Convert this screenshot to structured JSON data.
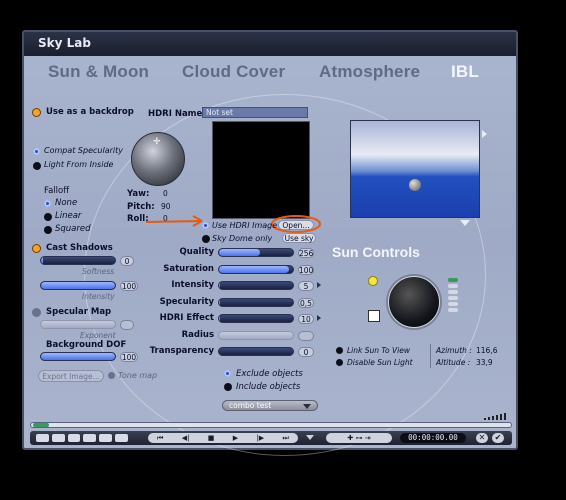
{
  "window": {
    "title": "Sky Lab"
  },
  "tabs": [
    "Sun & Moon",
    "Cloud Cover",
    "Atmosphere",
    "IBL"
  ],
  "left": {
    "use_backdrop": "Use as a backdrop",
    "compat_specularity": "Compat Specularity",
    "light_from_inside": "Light From Inside",
    "falloff_label": "Falloff",
    "falloff_options": [
      "None",
      "Linear",
      "Squared"
    ],
    "cast_shadows": "Cast Shadows",
    "softness_label": "Softness",
    "softness_value": "0",
    "intensity_label": "Intensity",
    "intensity_value": "100",
    "specular_map": "Specular Map",
    "exponent_label": "Exponent",
    "background_dof": "Background DOF",
    "dof_value": "100",
    "export_image": "Export Image...",
    "tone_map": "Tone map"
  },
  "hdri": {
    "name_label": "HDRI Name",
    "name_value": "Not set",
    "yaw_label": "Yaw:",
    "yaw_value": "0",
    "pitch_label": "Pitch:",
    "pitch_value": "90",
    "roll_label": "Roll:",
    "roll_value": "0",
    "use_hdri": "Use HDRI Image",
    "open_button": "Open...",
    "sky_dome_only": "Sky Dome only",
    "use_sky": "Use sky"
  },
  "params": [
    {
      "label": "Quality",
      "value": "256",
      "fill": 0.55
    },
    {
      "label": "Saturation",
      "value": "100",
      "fill": 0.95
    },
    {
      "label": "Intensity",
      "value": "5",
      "fill": 0.02
    },
    {
      "label": "Specularity",
      "value": "0,5",
      "fill": 0.02
    },
    {
      "label": "HDRI Effect",
      "value": "10",
      "fill": 0.02
    },
    {
      "label": "Radius",
      "value": "",
      "fill": 0
    },
    {
      "label": "Transparency",
      "value": "0",
      "fill": 0
    }
  ],
  "objects": {
    "exclude": "Exclude objects",
    "include": "Include objects",
    "combo": "combo test"
  },
  "sun": {
    "title": "Sun Controls",
    "link_sun": "Link Sun To View",
    "disable_light": "Disable Sun Light",
    "azimuth_label": "Azimuth :",
    "azimuth_value": "116,6",
    "altitude_label": "Altitude :",
    "altitude_value": "33,9"
  },
  "transport": {
    "time": "00:00:00.00"
  },
  "colors": {
    "accent_blue": "#4d74e6",
    "orange": "#f2a12c",
    "panel": "#a6b1cb",
    "annotation": "#e85a12"
  }
}
